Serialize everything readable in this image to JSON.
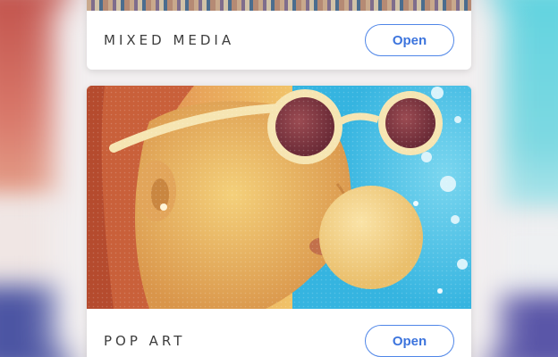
{
  "cards": [
    {
      "title": "MIXED MEDIA",
      "button": "Open"
    },
    {
      "title": "POP ART",
      "button": "Open"
    }
  ],
  "colors": {
    "accent": "#4f86e8",
    "card_background": "#ffffff",
    "title_text": "#3d3d3d"
  }
}
